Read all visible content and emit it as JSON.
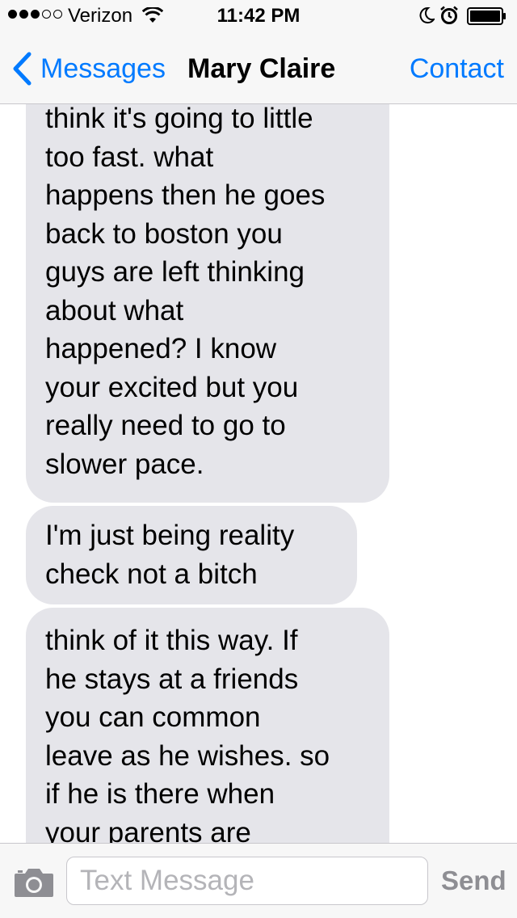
{
  "status_bar": {
    "carrier": "Verizon",
    "time": "11:42 PM",
    "signal_bars_filled": 3,
    "signal_bars_total": 5,
    "icons": [
      "wifi-icon",
      "moon-icon",
      "alarm-icon",
      "battery-icon"
    ]
  },
  "nav": {
    "back_label": "Messages",
    "title": "Mary Claire",
    "contact_label": "Contact",
    "accent_color": "#007aff"
  },
  "messages": [
    {
      "direction": "incoming",
      "lines": [
        "think it's going to little",
        "too fast. what",
        "happens then he goes",
        "back to boston you",
        "guys are left thinking",
        "about what",
        "happened? I know",
        "your excited but you",
        "really need to go to",
        "slower pace."
      ]
    },
    {
      "direction": "incoming",
      "lines": [
        "I'm just being reality",
        "check not a bitch"
      ]
    },
    {
      "direction": "incoming",
      "lines": [
        "think of it this way. If",
        "he stays at a friends",
        "you can common",
        "leave as he wishes. so",
        "if he is there when",
        "your parents are"
      ]
    }
  ],
  "composer": {
    "placeholder": "Text Message",
    "value": "",
    "send_label": "Send",
    "camera_icon": "camera-icon"
  },
  "colors": {
    "incoming_bubble": "#e5e5ea",
    "bar_background": "#f7f7f7",
    "send_disabled": "#8e8e93"
  }
}
